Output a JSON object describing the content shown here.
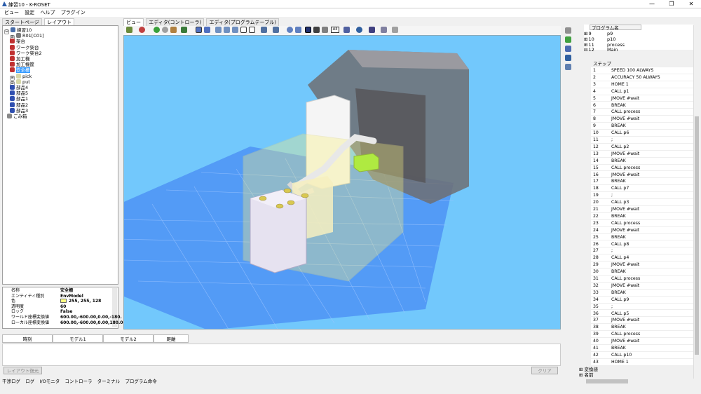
{
  "window": {
    "title": "練習10 - K-ROSET",
    "minimize": "—",
    "maximize": "❐",
    "close": "✕"
  },
  "menu": [
    "ビュー",
    "設定",
    "ヘルプ",
    "プラグイン"
  ],
  "left_tabs": [
    "スタートページ",
    "レイアウト"
  ],
  "tree": [
    {
      "label": "練習10",
      "color": "#4a6ea9",
      "expand": "⊟"
    },
    {
      "label": "R01[C01]",
      "color": "#7a7a7a",
      "expand": "⊞"
    },
    {
      "label": "架台",
      "color": "#c03030"
    },
    {
      "label": "ワーク架台",
      "color": "#c03030"
    },
    {
      "label": "ワーク架台2",
      "color": "#c03030"
    },
    {
      "label": "加工機",
      "color": "#c03030"
    },
    {
      "label": "加工機筐",
      "color": "#c03030"
    },
    {
      "label": "安全柵",
      "color": "#c03030",
      "selected": true
    },
    {
      "label": "pick",
      "color": "#d8d8a8",
      "expand": "⊞"
    },
    {
      "label": "put",
      "color": "#d8d8a8",
      "expand": "⊞"
    },
    {
      "label": "部品4",
      "color": "#3050b0"
    },
    {
      "label": "部品5",
      "color": "#3050b0"
    },
    {
      "label": "部品1",
      "color": "#3050b0"
    },
    {
      "label": "部品2",
      "color": "#3050b0"
    },
    {
      "label": "部品3",
      "color": "#3050b0"
    },
    {
      "label": "ごみ箱",
      "color": "#888888"
    }
  ],
  "properties": [
    {
      "key": "名称",
      "value": "安全柵"
    },
    {
      "key": "エンティティ種別",
      "value": "EnvModel"
    },
    {
      "key": "色",
      "value": "255, 255, 128",
      "swatch": "#ffff80"
    },
    {
      "key": "透明度",
      "value": "60"
    },
    {
      "key": "ロック",
      "value": "False"
    },
    {
      "key": "ワールド座標変換値",
      "value": "600.00,-600.00,0.00,-180."
    },
    {
      "key": "ローカル座標変換値",
      "value": "600.00,-600.00,0.00,180.0"
    }
  ],
  "view_tabs": [
    "ビュー",
    "エディタ(コントローラ)",
    "エディタ(プログラムテーブル)"
  ],
  "toolbar": {
    "all_label": "All"
  },
  "bottom_columns": [
    "時刻",
    "モデル1",
    "モデル2",
    "距離"
  ],
  "buttons": {
    "restore_layout": "レイアウト復元",
    "clear": "クリア"
  },
  "log_tabs": [
    "干渉ログ",
    "ログ",
    "I/Oモニタ",
    "コントローラ",
    "ターミナル",
    "プログラム命令"
  ],
  "program": {
    "header": "プログラム名",
    "rows": [
      {
        "num": "9",
        "name": "p9"
      },
      {
        "num": "10",
        "name": "p10"
      },
      {
        "num": "11",
        "name": "process"
      },
      {
        "num": "12",
        "name": "Main"
      }
    ]
  },
  "steps": {
    "header": "ステップ",
    "rows": [
      {
        "n": "1",
        "c": "SPEED 100 ALWAYS"
      },
      {
        "n": "2",
        "c": "ACCURACY 50 ALWAYS"
      },
      {
        "n": "3",
        "c": "HOME 1"
      },
      {
        "n": "4",
        "c": "CALL p1"
      },
      {
        "n": "5",
        "c": "JMOVE #wait"
      },
      {
        "n": "6",
        "c": "BREAK"
      },
      {
        "n": "7",
        "c": "CALL process"
      },
      {
        "n": "8",
        "c": "JMOVE #wait"
      },
      {
        "n": "9",
        "c": "BREAK"
      },
      {
        "n": "10",
        "c": "CALL p6"
      },
      {
        "n": "11",
        "c": ";"
      },
      {
        "n": "12",
        "c": "CALL p2"
      },
      {
        "n": "13",
        "c": "JMOVE #wait"
      },
      {
        "n": "14",
        "c": "BREAK"
      },
      {
        "n": "15",
        "c": "CALL process"
      },
      {
        "n": "16",
        "c": "JMOVE #wait"
      },
      {
        "n": "17",
        "c": "BREAK"
      },
      {
        "n": "18",
        "c": "CALL p7"
      },
      {
        "n": "19",
        "c": ";"
      },
      {
        "n": "20",
        "c": "CALL p3"
      },
      {
        "n": "21",
        "c": "JMOVE #wait"
      },
      {
        "n": "22",
        "c": "BREAK"
      },
      {
        "n": "23",
        "c": "CALL process"
      },
      {
        "n": "24",
        "c": "JMOVE #wait"
      },
      {
        "n": "25",
        "c": "BREAK"
      },
      {
        "n": "26",
        "c": "CALL p8"
      },
      {
        "n": "27",
        "c": ";"
      },
      {
        "n": "28",
        "c": "CALL p4"
      },
      {
        "n": "29",
        "c": "JMOVE #wait"
      },
      {
        "n": "30",
        "c": "BREAK"
      },
      {
        "n": "31",
        "c": "CALL process"
      },
      {
        "n": "32",
        "c": "JMOVE #wait"
      },
      {
        "n": "33",
        "c": "BREAK"
      },
      {
        "n": "34",
        "c": "CALL p9"
      },
      {
        "n": "35",
        "c": ";"
      },
      {
        "n": "36",
        "c": "CALL p5"
      },
      {
        "n": "37",
        "c": "JMOVE #wait"
      },
      {
        "n": "38",
        "c": "BREAK"
      },
      {
        "n": "39",
        "c": "CALL process"
      },
      {
        "n": "40",
        "c": "JMOVE #wait"
      },
      {
        "n": "41",
        "c": "BREAK"
      },
      {
        "n": "42",
        "c": "CALL p10"
      },
      {
        "n": "43",
        "c": "HOME 1"
      }
    ]
  },
  "right_sections": [
    "変換値",
    "名前"
  ]
}
